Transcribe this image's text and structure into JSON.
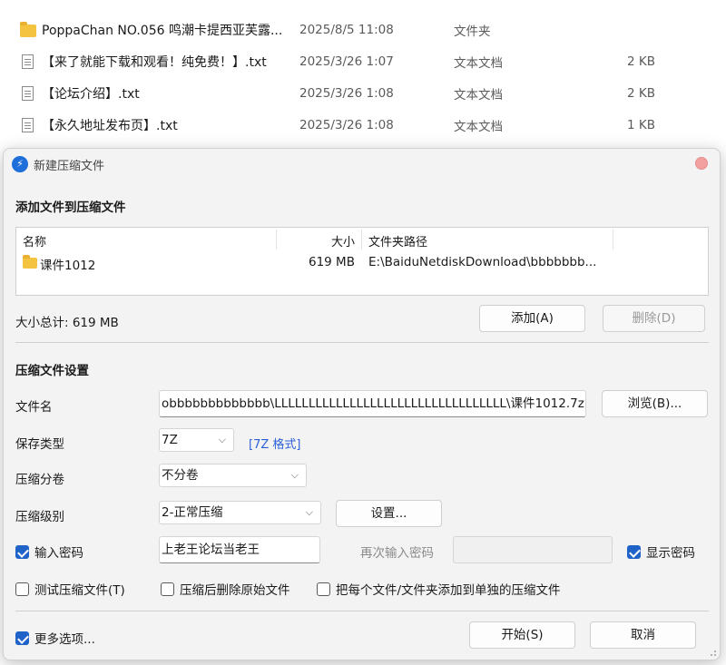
{
  "explorer": {
    "rows": [
      {
        "icon": "folder-icon",
        "name": "PoppaChan NO.056 鸣潮卡提西亚芙露...",
        "date": "2025/8/5 11:08",
        "type": "文件夹",
        "size": ""
      },
      {
        "icon": "text-file-icon",
        "name": "【来了就能下载和观看！纯免费！】.txt",
        "date": "2025/3/26 1:07",
        "type": "文本文档",
        "size": "2 KB"
      },
      {
        "icon": "text-file-icon",
        "name": "【论坛介绍】.txt",
        "date": "2025/3/26 1:08",
        "type": "文本文档",
        "size": "2 KB"
      },
      {
        "icon": "text-file-icon",
        "name": "【永久地址发布页】.txt",
        "date": "2025/3/26 1:08",
        "type": "文本文档",
        "size": "1 KB"
      }
    ]
  },
  "dialog": {
    "title": "新建压缩文件",
    "add_section_title": "添加文件到压缩文件",
    "list": {
      "col_name": "名称",
      "col_size": "大小",
      "col_path": "文件夹路径",
      "rows": [
        {
          "name": "课件1012",
          "size": "619 MB",
          "path": "E:\\BaiduNetdiskDownload\\bbbbbbb..."
        }
      ]
    },
    "total_size": "大小总计: 619 MB",
    "add_button": "添加(A)",
    "delete_button": "删除(D)",
    "settings_section_title": "压缩文件设置",
    "filename_label": "文件名",
    "filename_value": "obbbbbbbbbbbbb\\LLLLLLLLLLLLLLLLLLLLLLLLLLLLLLLLLL\\课件1012.7z",
    "browse_button": "浏览(B)...",
    "save_type_label": "保存类型",
    "save_type_value": "7Z",
    "format_link": "[7Z 格式]",
    "split_label": "压缩分卷",
    "split_value": "不分卷",
    "level_label": "压缩级别",
    "level_value": "2-正常压缩",
    "level_settings_button": "设置...",
    "password_checkbox": "输入密码",
    "password_checked": true,
    "password_value": "上老王论坛当老王",
    "reenter_label": "再次输入密码",
    "reenter_value": "",
    "show_password_checkbox": "显示密码",
    "show_password_checked": true,
    "test_checkbox": "测试压缩文件(T)",
    "test_checked": false,
    "delete_after_checkbox": "压缩后删除原始文件",
    "delete_after_checked": false,
    "separate_checkbox": "把每个文件/文件夹添加到单独的压缩文件",
    "separate_checked": false,
    "more_options_checkbox": "更多选项...",
    "more_options_checked": true,
    "start_button": "开始(S)",
    "cancel_button": "取消"
  },
  "colors": {
    "accent": "#1f63c9",
    "link": "#2b5fd9",
    "folder": "#f4c441"
  }
}
